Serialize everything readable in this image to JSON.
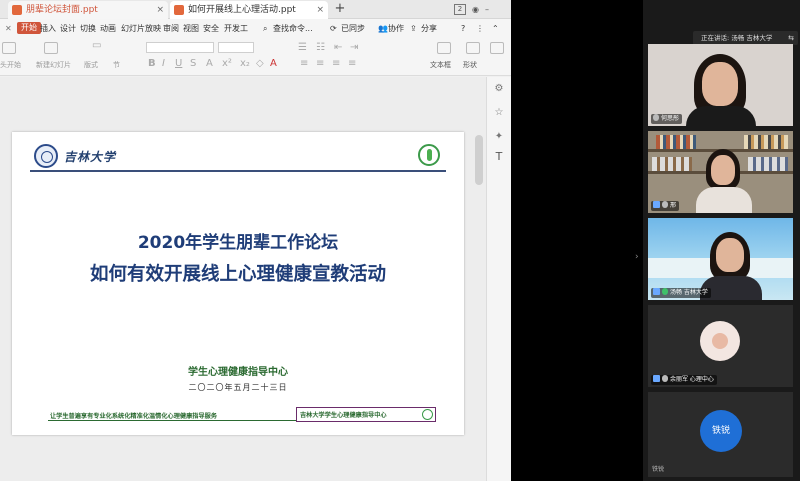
{
  "tabs": {
    "tab1": "朋辈论坛封面.ppt",
    "tab2": "如何开展线上心理活动.ppt",
    "add": "+",
    "count": "2"
  },
  "menu": {
    "start": "开始",
    "items": [
      "插入",
      "设计",
      "切换",
      "动画",
      "幻灯片放映",
      "审阅",
      "视图",
      "安全",
      "开发工"
    ],
    "search": "查找命令...",
    "sync": "已同步",
    "collab": "协作",
    "share": "分享"
  },
  "ribbon": {
    "from_current": "头开始",
    "new_slide": "新建幻灯片",
    "layout": "版式",
    "section": "节",
    "textbox": "文本框",
    "shape": "形状"
  },
  "slide": {
    "university": "吉林大学",
    "title1": "2020年学生朋辈工作论坛",
    "title2": "如何有效开展线上心理健康宣教活动",
    "org": "学生心理健康指导中心",
    "date": "二〇二〇年五月二十三日",
    "footer_left": "让学生普遍享有专业化系统化精准化温情化心理健康指导服务",
    "footer_right": "吉林大学学生心理健康指导中心"
  },
  "meeting": {
    "speaking": "正在讲话: 汤畅 吉林大学",
    "tiles": [
      {
        "name": "何思彤"
      },
      {
        "name": "邢"
      },
      {
        "name": "汤畅 吉林大学"
      },
      {
        "name": "余丽军 心理中心"
      },
      {
        "avatar_text": "铁锐",
        "name": "铁锐"
      }
    ]
  }
}
